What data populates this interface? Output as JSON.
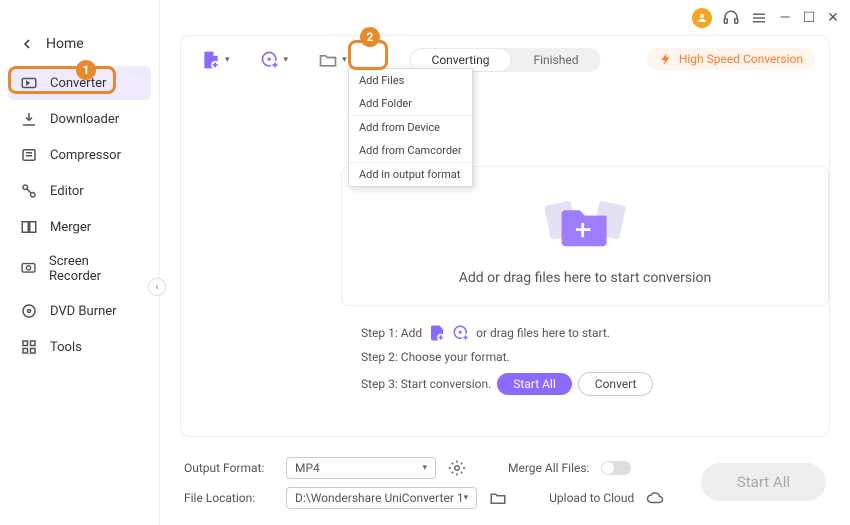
{
  "window": {
    "avatar_color": "#f5a623"
  },
  "nav": {
    "back": "Home",
    "items": [
      {
        "label": "Converter",
        "active": true
      },
      {
        "label": "Downloader"
      },
      {
        "label": "Compressor"
      },
      {
        "label": "Editor"
      },
      {
        "label": "Merger"
      },
      {
        "label": "Screen Recorder"
      },
      {
        "label": "DVD Burner"
      },
      {
        "label": "Tools"
      }
    ]
  },
  "badges": {
    "one": "1",
    "two": "2"
  },
  "tabs": {
    "converting": "Converting",
    "finished": "Finished"
  },
  "hsc": "High Speed Conversion",
  "dropdown": {
    "add_files": "Add Files",
    "add_folder": "Add Folder",
    "add_device": "Add from Device",
    "add_camcorder": "Add from Camcorder",
    "add_output": "Add in output format"
  },
  "dropzone": {
    "text": "Add or drag files here to start conversion"
  },
  "steps": {
    "s1_prefix": "Step 1: Add",
    "s1_suffix": "or drag files here to start.",
    "s2": "Step 2: Choose your format.",
    "s3": "Step 3: Start conversion.",
    "start_all": "Start All",
    "convert": "Convert"
  },
  "footer": {
    "output_label": "Output Format:",
    "output_value": "MP4",
    "location_label": "File Location:",
    "location_value": "D:\\Wondershare UniConverter 1",
    "merge_label": "Merge All Files:",
    "cloud_label": "Upload to Cloud"
  },
  "start_all_btn": "Start All"
}
